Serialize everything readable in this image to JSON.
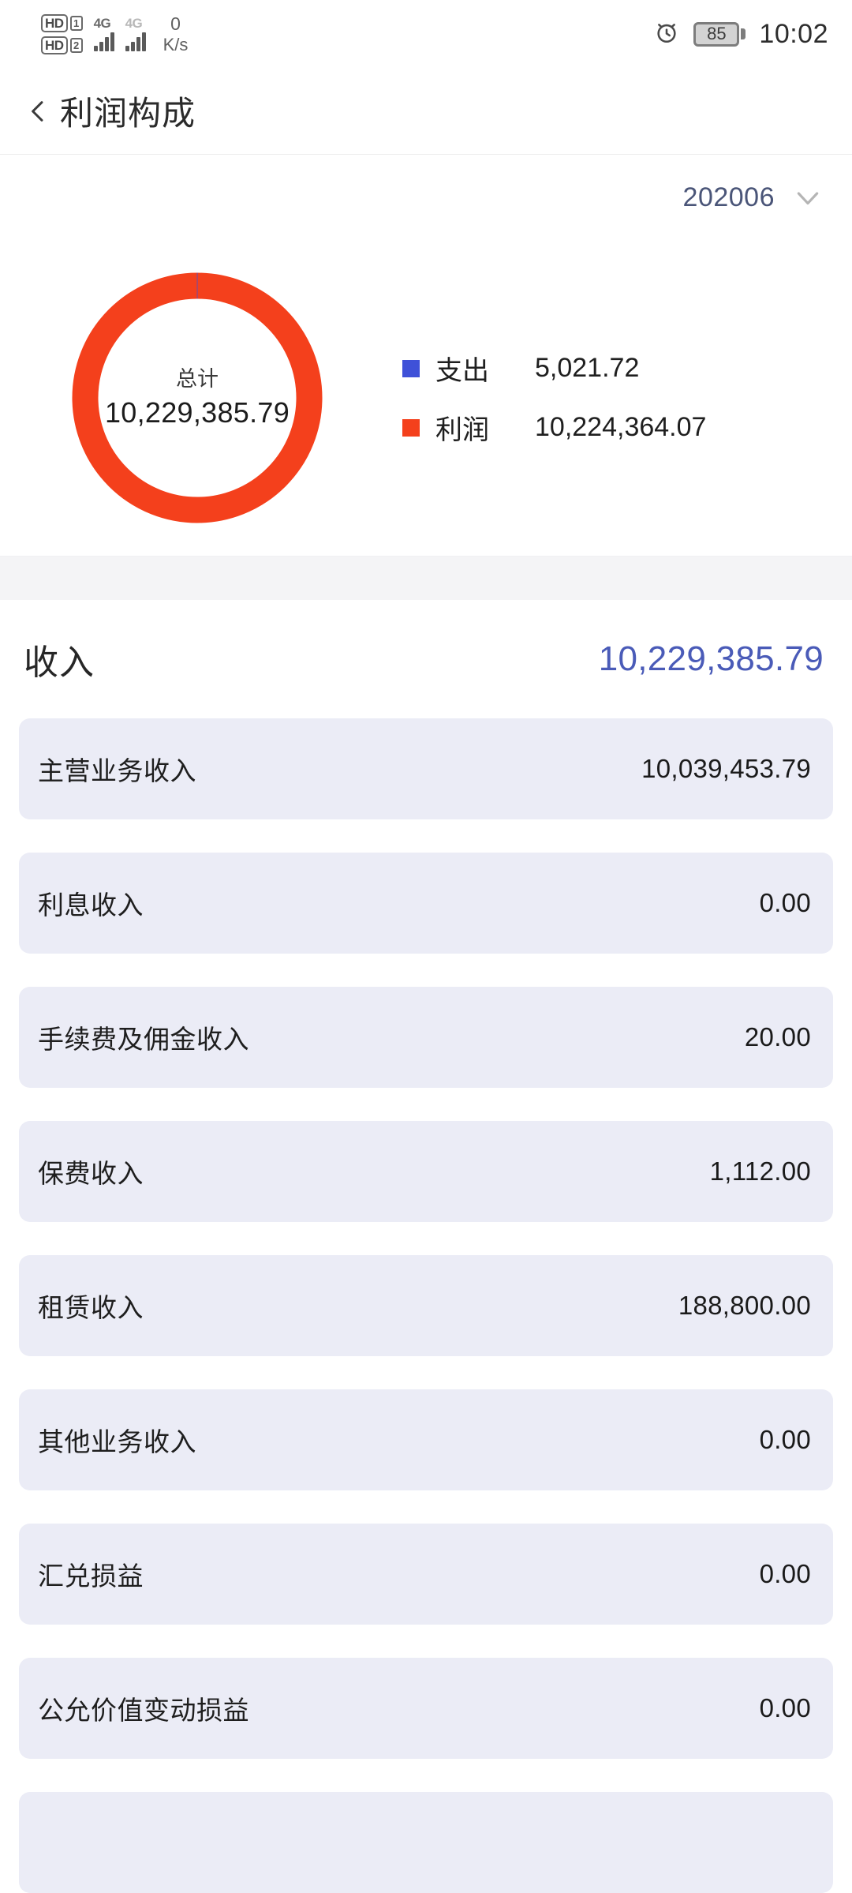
{
  "status_bar": {
    "hd_badges": [
      {
        "label": "HD",
        "sim": "1"
      },
      {
        "label": "HD",
        "sim": "2"
      }
    ],
    "signals": [
      {
        "network": "4G"
      },
      {
        "network": "4G"
      }
    ],
    "net_speed_value": "0",
    "net_speed_unit": "K/s",
    "alarm_icon": "alarm-clock-icon",
    "battery_percent": "85",
    "time": "10:02"
  },
  "header": {
    "back_icon": "chevron-left-icon",
    "title": "利润构成"
  },
  "period": {
    "value": "202006",
    "chevron_icon": "chevron-down-icon"
  },
  "chart_data": {
    "type": "pie",
    "title": "利润构成",
    "subtitle": "202006",
    "center_label": "总计",
    "center_value": "10,229,385.79",
    "categories": [
      "支出",
      "利润"
    ],
    "values": [
      5021.72,
      10224364.07
    ],
    "value_labels": [
      "5,021.72",
      "10,224,364.07"
    ],
    "colors": [
      "#3f51d8",
      "#f4401c"
    ],
    "legend_position": "right",
    "donut": true,
    "total": 10229385.79
  },
  "legend": [
    {
      "name": "支出",
      "value": "5,021.72",
      "color": "#3f51d8"
    },
    {
      "name": "利润",
      "value": "10,224,364.07",
      "color": "#f4401c"
    }
  ],
  "income_section": {
    "title": "收入",
    "total": "10,229,385.79",
    "rows": [
      {
        "label": "主营业务收入",
        "value": "10,039,453.79"
      },
      {
        "label": "利息收入",
        "value": "0.00"
      },
      {
        "label": "手续费及佣金收入",
        "value": "20.00"
      },
      {
        "label": "保费收入",
        "value": "1,112.00"
      },
      {
        "label": "租赁收入",
        "value": "188,800.00"
      },
      {
        "label": "其他业务收入",
        "value": "0.00"
      },
      {
        "label": "汇兑损益",
        "value": "0.00"
      },
      {
        "label": "公允价值变动损益",
        "value": "0.00"
      },
      {
        "label": "",
        "value": ""
      }
    ]
  },
  "colors": {
    "accent_red": "#f4401c",
    "accent_blue": "#3f51d8",
    "value_blue": "#4a5bb8",
    "row_bg": "#ebecf6",
    "band_bg": "#f4f4f6"
  }
}
